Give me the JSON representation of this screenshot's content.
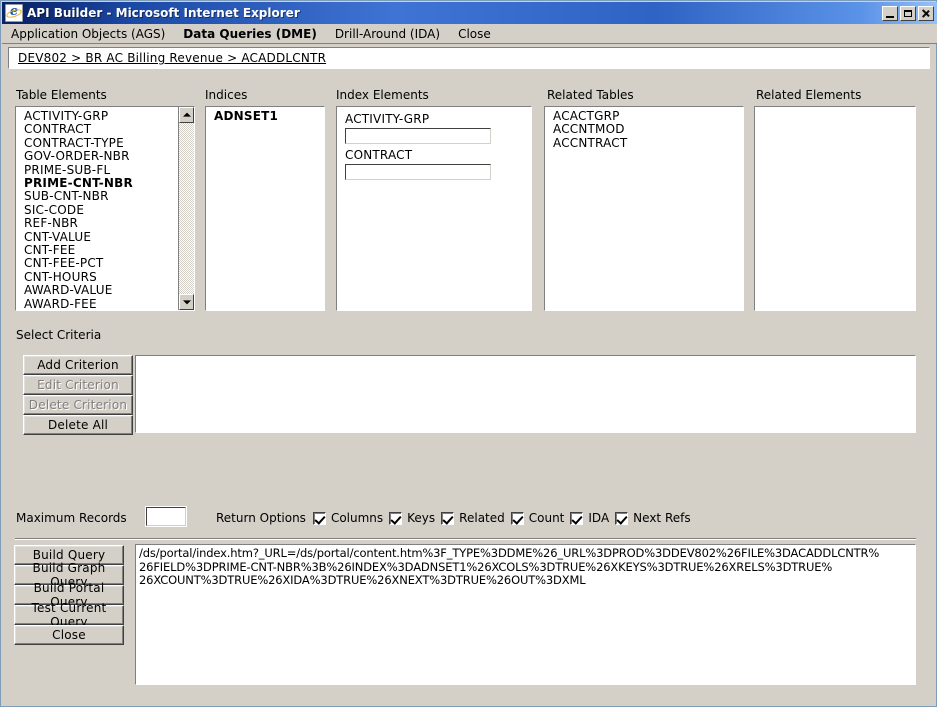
{
  "window": {
    "title": "API Builder - Microsoft Internet Explorer",
    "icon": "internet-explorer-icon",
    "buttons": {
      "minimize": "_",
      "maximize": "▭",
      "close": "✕"
    }
  },
  "menu": {
    "items": [
      {
        "label": "Application Objects (AGS)",
        "active": false
      },
      {
        "label": "Data Queries (DME)",
        "active": true
      },
      {
        "label": "Drill-Around (IDA)",
        "active": false
      },
      {
        "label": "Close",
        "active": false
      }
    ]
  },
  "breadcrumb": {
    "text": "DEV802 > BR AC Billing Revenue > ACADDLCNTR"
  },
  "panels": {
    "table_elements": {
      "label": "Table Elements",
      "selected": "PRIME-CNT-NBR",
      "items": [
        "ACTIVITY-GRP",
        "CONTRACT",
        "CONTRACT-TYPE",
        "GOV-ORDER-NBR",
        "PRIME-SUB-FL",
        "PRIME-CNT-NBR",
        "SUB-CNT-NBR",
        "SIC-CODE",
        "REF-NBR",
        "CNT-VALUE",
        "CNT-FEE",
        "CNT-FEE-PCT",
        "CNT-HOURS",
        "AWARD-VALUE",
        "AWARD-FEE"
      ]
    },
    "indices": {
      "label": "Indices",
      "selected": "ADNSET1",
      "items": [
        "ADNSET1"
      ]
    },
    "index_elements": {
      "label": "Index Elements",
      "fields": [
        {
          "label": "ACTIVITY-GRP",
          "value": ""
        },
        {
          "label": "CONTRACT",
          "value": ""
        }
      ]
    },
    "related_tables": {
      "label": "Related Tables",
      "items": [
        "ACACTGRP",
        "ACCNTMOD",
        "ACCNTRACT"
      ]
    },
    "related_elements": {
      "label": "Related Elements",
      "items": []
    }
  },
  "select_criteria": {
    "label": "Select Criteria",
    "buttons": [
      {
        "label": "Add Criterion",
        "disabled": false
      },
      {
        "label": "Edit Criterion",
        "disabled": true
      },
      {
        "label": "Delete Criterion",
        "disabled": true
      },
      {
        "label": "Delete All",
        "disabled": false
      }
    ],
    "list_items": []
  },
  "options": {
    "max_records_label": "Maximum Records",
    "max_records_value": "",
    "return_options_label": "Return Options",
    "checkboxes": [
      {
        "label": "Columns",
        "checked": true
      },
      {
        "label": "Keys",
        "checked": true
      },
      {
        "label": "Related",
        "checked": true
      },
      {
        "label": "Count",
        "checked": true
      },
      {
        "label": "IDA",
        "checked": true
      },
      {
        "label": "Next Refs",
        "checked": true
      }
    ]
  },
  "actions": {
    "buttons": [
      {
        "label": "Build Query"
      },
      {
        "label": "Build Graph Query"
      },
      {
        "label": "Build Portal Query"
      },
      {
        "label": "Test Current Query"
      },
      {
        "label": "Close"
      }
    ]
  },
  "url_output": {
    "lines": [
      "/ds/portal/index.htm?_URL=/ds/portal/content.htm%3F_TYPE%3DDME%26_URL%3DPROD%3DDEV802%26FILE%3DACADDLCNTR%",
      "26FIELD%3DPRIME-CNT-NBR%3B%26INDEX%3DADNSET1%26XCOLS%3DTRUE%26XKEYS%3DTRUE%26XRELS%3DTRUE%",
      "26XCOUNT%3DTRUE%26XIDA%3DTRUE%26XNEXT%3DTRUE%26OUT%3DXML"
    ]
  },
  "colors": {
    "face": "#d4d0c8",
    "title_start": "#0a246a",
    "title_end": "#97c0f5",
    "field": "#ffffff",
    "disabled_text": "#808080"
  }
}
